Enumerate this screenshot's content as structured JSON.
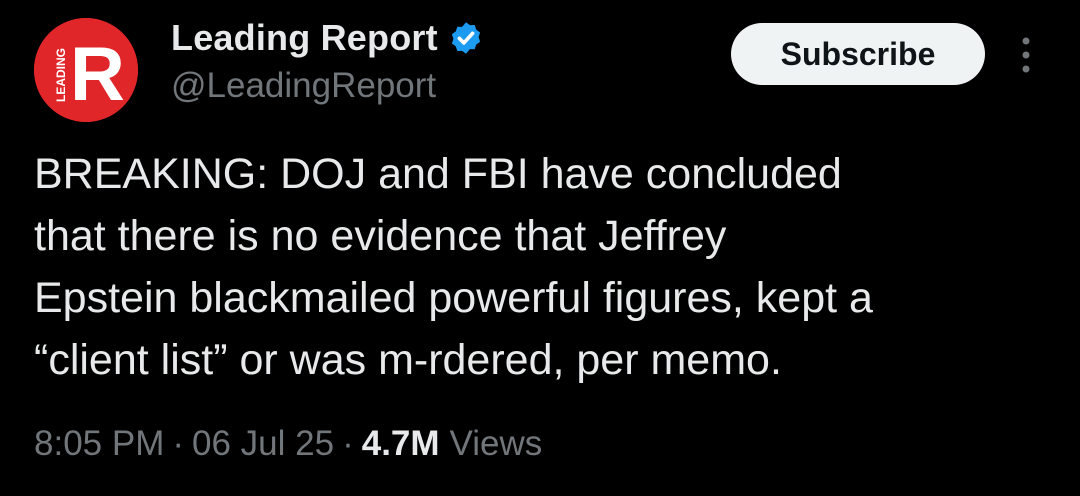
{
  "author": {
    "display_name": "Leading Report",
    "handle": "@LeadingReport",
    "avatar_letter": "R",
    "avatar_vertical_text": "LEADING",
    "avatar_color": "#e1262a",
    "verified_icon": "verified-badge-icon",
    "verified_color": "#1d9bf0"
  },
  "actions": {
    "subscribe_label": "Subscribe",
    "more_icon": "more-vertical-icon"
  },
  "tweet": {
    "lines": [
      "BREAKING: DOJ and FBI have concluded",
      "that there is no evidence that Jeffrey",
      "Epstein blackmailed powerful figures, kept a",
      "“client list” or was m-rdered, per memo."
    ]
  },
  "meta": {
    "time": "8:05 PM",
    "separator": "·",
    "date": "06 Jul 25",
    "views_count": "4.7M",
    "views_label": "Views"
  }
}
